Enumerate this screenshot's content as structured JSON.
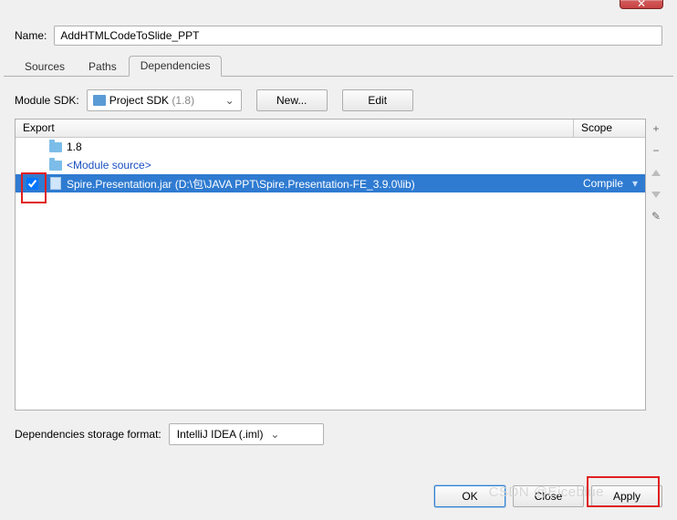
{
  "titlebar": {
    "close_glyph": "✕"
  },
  "name": {
    "label": "Name:",
    "value": "AddHTMLCodeToSlide_PPT"
  },
  "tabs": [
    {
      "label": "Sources",
      "active": false
    },
    {
      "label": "Paths",
      "active": false
    },
    {
      "label": "Dependencies",
      "active": true
    }
  ],
  "module_sdk": {
    "label": "Module SDK:",
    "selected_main": "Project SDK",
    "selected_suffix": "(1.8)",
    "new_label": "New...",
    "edit_label": "Edit"
  },
  "deps": {
    "header_export": "Export",
    "header_scope": "Scope",
    "rows": [
      {
        "checked": false,
        "icon": "folder",
        "label": "1.8",
        "link": false,
        "scope": "",
        "selected": false,
        "show_chk": false
      },
      {
        "checked": false,
        "icon": "folder",
        "label": "<Module source>",
        "link": true,
        "scope": "",
        "selected": false,
        "show_chk": false
      },
      {
        "checked": true,
        "icon": "jar",
        "label": "Spire.Presentation.jar (D:\\包\\JAVA PPT\\Spire.Presentation-FE_3.9.0\\lib)",
        "link": false,
        "scope": "Compile",
        "selected": true,
        "show_chk": true
      }
    ]
  },
  "side_tools": {
    "plus": "+",
    "minus": "−",
    "pencil": "✎"
  },
  "storage": {
    "label": "Dependencies storage format:",
    "selected": "IntelliJ IDEA (.iml)"
  },
  "footer": {
    "ok": "OK",
    "cancel": "Close",
    "apply": "Apply"
  },
  "watermark": "CSDN @Eiceblue"
}
